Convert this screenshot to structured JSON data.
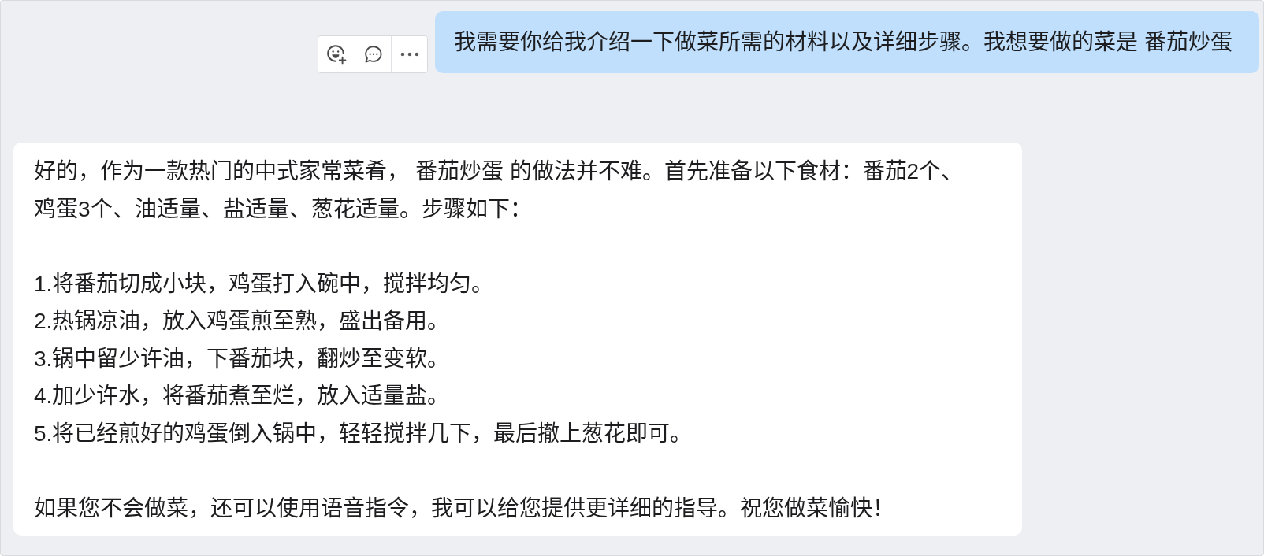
{
  "user_message": {
    "text": "我需要你给我介绍一下做菜所需的材料以及详细步骤。我想要做的菜是 番茄炒蛋"
  },
  "reply": {
    "intro": "好的，作为一款热门的中式家常菜肴， 番茄炒蛋 的做法并不难。首先准备以下食材：番茄2个、鸡蛋3个、油适量、盐适量、葱花适量。步骤如下：",
    "steps": [
      "1.将番茄切成小块，鸡蛋打入碗中，搅拌均匀。",
      "2.热锅凉油，放入鸡蛋煎至熟，盛出备用。",
      "3.锅中留少许油，下番茄块，翻炒至变软。",
      "4.加少许水，将番茄煮至烂，放入适量盐。",
      "5.将已经煎好的鸡蛋倒入锅中，轻轻搅拌几下，最后撤上葱花即可。"
    ],
    "closing": "如果您不会做菜，还可以使用语音指令，我可以给您提供更详细的指导。祝您做菜愉快！"
  }
}
